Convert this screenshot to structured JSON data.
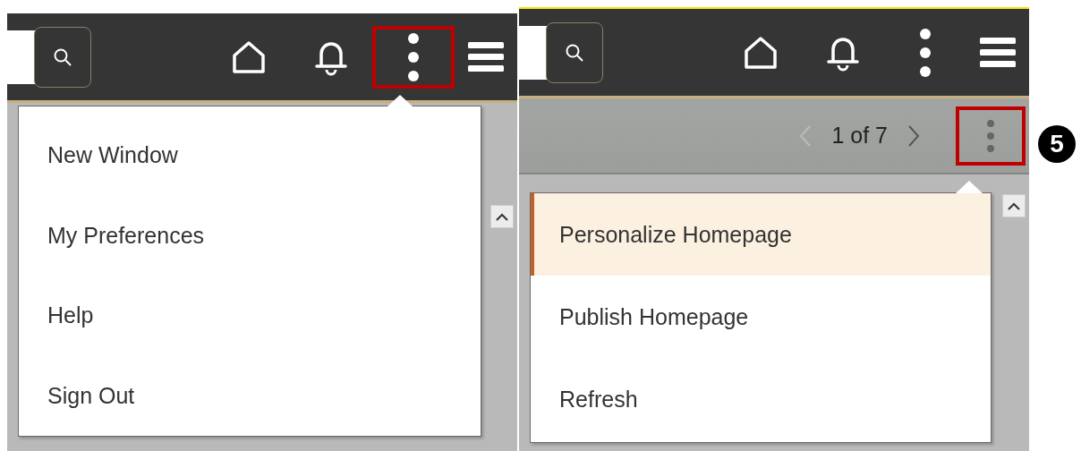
{
  "panels": [
    {
      "kind": "menu_open",
      "header": {
        "actions_highlighted": true
      },
      "menu": {
        "items": [
          {
            "label": "New Window",
            "selected": false
          },
          {
            "label": "My Preferences",
            "selected": false
          },
          {
            "label": "Help",
            "selected": false
          },
          {
            "label": "Sign Out",
            "selected": false
          }
        ]
      }
    },
    {
      "kind": "menu_open",
      "header": {
        "actions_highlighted": false
      },
      "toolbar": {
        "pager": "1 of 7",
        "actions_highlighted": true
      },
      "menu": {
        "items": [
          {
            "label": "Personalize Homepage",
            "selected": true
          },
          {
            "label": "Publish Homepage",
            "selected": false
          },
          {
            "label": "Refresh",
            "selected": false
          }
        ]
      }
    }
  ],
  "callout": "5"
}
